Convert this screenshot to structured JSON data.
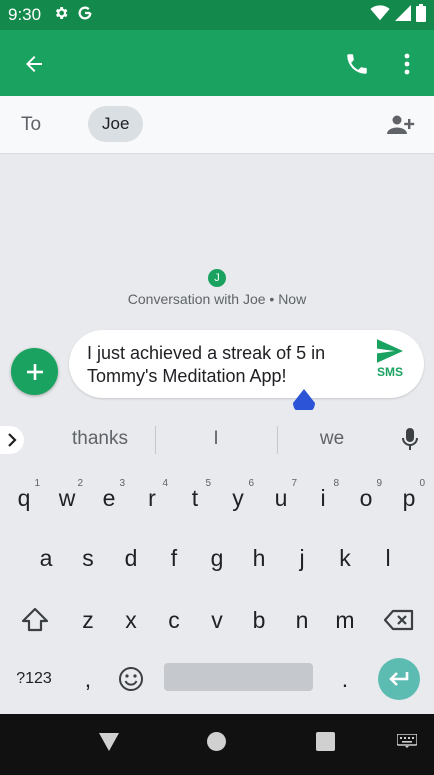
{
  "status_bar": {
    "time": "9:30",
    "icons": [
      "settings-gear-icon",
      "google-g-icon",
      "wifi-icon",
      "signal-icon",
      "battery-icon"
    ]
  },
  "app_bar": {
    "back_icon": "arrow-left-icon",
    "call_icon": "phone-icon",
    "more_icon": "more-vert-icon",
    "colors": {
      "status": "#138a4b",
      "bar": "#1aa260"
    }
  },
  "recipient": {
    "to_label": "To",
    "chip_name": "Joe",
    "add_icon": "add-person-icon"
  },
  "conversation": {
    "avatar_initial": "J",
    "caption": "Conversation with Joe • Now"
  },
  "compose": {
    "add_icon": "plus-icon",
    "message_text": "I just achieved a streak of 5 in Tommy's Meditation App!",
    "send_label": "SMS",
    "send_icon": "send-icon"
  },
  "keyboard": {
    "suggestions": [
      "thanks",
      "I",
      "we"
    ],
    "expand_icon": "chevron-right-icon",
    "mic_icon": "mic-icon",
    "row1": [
      {
        "k": "q",
        "h": "1"
      },
      {
        "k": "w",
        "h": "2"
      },
      {
        "k": "e",
        "h": "3"
      },
      {
        "k": "r",
        "h": "4"
      },
      {
        "k": "t",
        "h": "5"
      },
      {
        "k": "y",
        "h": "6"
      },
      {
        "k": "u",
        "h": "7"
      },
      {
        "k": "i",
        "h": "8"
      },
      {
        "k": "o",
        "h": "9"
      },
      {
        "k": "p",
        "h": "0"
      }
    ],
    "row2": [
      "a",
      "s",
      "d",
      "f",
      "g",
      "h",
      "j",
      "k",
      "l"
    ],
    "row3": [
      "z",
      "x",
      "c",
      "v",
      "b",
      "n",
      "m"
    ],
    "shift_icon": "shift-icon",
    "backspace_icon": "backspace-icon",
    "symbols_label": "?123",
    "comma": ",",
    "emoji_icon": "emoji-icon",
    "period": ".",
    "enter_icon": "enter-icon"
  },
  "nav_bar": {
    "icons": [
      "nav-back-icon",
      "nav-home-icon",
      "nav-recents-icon",
      "keyboard-icon"
    ]
  }
}
